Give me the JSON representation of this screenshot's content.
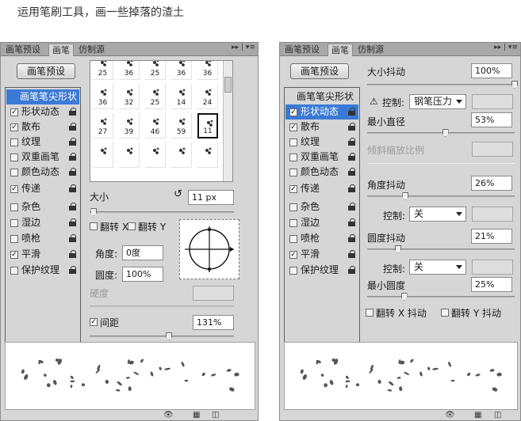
{
  "caption": "运用笔刷工具，画一些掉落的渣土",
  "left_panel": {
    "tabs": [
      "画笔预设",
      "画笔",
      "仿制源"
    ],
    "active_tab": 1,
    "preset_button": "画笔预设",
    "sidebar": {
      "heading": "画笔笔尖形状",
      "items": [
        {
          "label": "形状动态",
          "checked": true
        },
        {
          "label": "散布",
          "checked": true
        },
        {
          "label": "纹理",
          "checked": false
        },
        {
          "label": "双重画笔",
          "checked": false
        },
        {
          "label": "颜色动态",
          "checked": false
        },
        {
          "label": "传递",
          "checked": true
        },
        {
          "label": "杂色",
          "checked": false
        },
        {
          "label": "湿边",
          "checked": false
        },
        {
          "label": "喷枪",
          "checked": false
        },
        {
          "label": "平滑",
          "checked": true
        },
        {
          "label": "保护纹理",
          "checked": false
        }
      ]
    },
    "brush_tips": [
      [
        "25",
        "36",
        "25",
        "36",
        "36"
      ],
      [
        "36",
        "32",
        "25",
        "14",
        "24"
      ],
      [
        "27",
        "39",
        "46",
        "59",
        "11"
      ],
      [
        "",
        "",
        "",
        "",
        ""
      ]
    ],
    "selected_tip": "11",
    "size_label": "大小",
    "size_value": "11 px",
    "flip_x": "翻转 X",
    "flip_y": "翻转 Y",
    "angle_label": "角度:",
    "angle_value": "0度",
    "roundness_label": "圆度:",
    "roundness_value": "100%",
    "hardness_label": "硬度",
    "spacing_label": "间距",
    "spacing_checked": true,
    "spacing_value": "131%"
  },
  "right_panel": {
    "tabs": [
      "画笔预设",
      "画笔",
      "仿制源"
    ],
    "active_tab": 1,
    "preset_button": "画笔预设",
    "sidebar": {
      "heading": "画笔笔尖形状",
      "selected": "形状动态",
      "items": [
        {
          "label": "形状动态",
          "checked": true
        },
        {
          "label": "散布",
          "checked": true
        },
        {
          "label": "纹理",
          "checked": false
        },
        {
          "label": "双重画笔",
          "checked": false
        },
        {
          "label": "颜色动态",
          "checked": false
        },
        {
          "label": "传递",
          "checked": true
        },
        {
          "label": "杂色",
          "checked": false
        },
        {
          "label": "湿边",
          "checked": false
        },
        {
          "label": "喷枪",
          "checked": false
        },
        {
          "label": "平滑",
          "checked": true
        },
        {
          "label": "保护纹理",
          "checked": false
        }
      ]
    },
    "size_jitter_label": "大小抖动",
    "size_jitter_value": "100%",
    "size_jitter_level": 1.0,
    "control_label": "控制:",
    "control_value_1": "钢笔压力",
    "min_diameter_label": "最小直径",
    "min_diameter_value": "53%",
    "min_diameter_level": 0.53,
    "tilt_scale_label": "倾斜缩放比例",
    "angle_jitter_label": "角度抖动",
    "angle_jitter_value": "26%",
    "angle_jitter_level": 0.26,
    "control_value_2": "关",
    "roundness_jitter_label": "圆度抖动",
    "roundness_jitter_value": "21%",
    "roundness_jitter_level": 0.21,
    "control_value_3": "关",
    "min_roundness_label": "最小圆度",
    "min_roundness_value": "25%",
    "min_roundness_level": 0.25,
    "flip_x_jitter": "翻转 X 抖动",
    "flip_y_jitter": "翻转 Y 抖动"
  },
  "left_size_level": 0.03,
  "left_spacing_level": 0.55
}
